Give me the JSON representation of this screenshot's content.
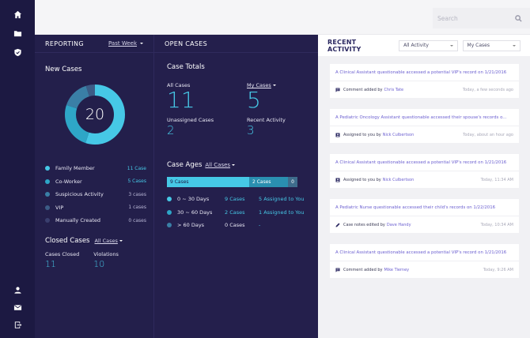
{
  "nav": {
    "top": [
      "home-icon",
      "folder-icon",
      "shield-icon"
    ],
    "bottom": [
      "user-icon",
      "mail-icon",
      "logout-icon"
    ]
  },
  "search": {
    "placeholder": "Search"
  },
  "reporting": {
    "title": "REPORTING",
    "period": "Past Week",
    "new_cases_title": "New Cases",
    "total": "20",
    "legend": [
      {
        "label": "Family Member",
        "count": "11 Case",
        "color": "#46c8e6",
        "value": 11
      },
      {
        "label": "Co-Worker",
        "count": "5 Cases",
        "color": "#2ea6c7",
        "value": 5
      },
      {
        "label": "Suspicious Activity",
        "count": "3 cases",
        "color": "#3a7fa6",
        "value": 3
      },
      {
        "label": "VIP",
        "count": "1 cases",
        "color": "#3c5c86",
        "value": 1
      },
      {
        "label": "Manually Created",
        "count": "0 cases",
        "color": "#3a3f6e",
        "value": 0
      }
    ],
    "closed": {
      "title": "Closed Cases",
      "filter": "All Cases",
      "cases_closed_label": "Cases Closed",
      "cases_closed_value": "11",
      "violations_label": "Violations",
      "violations_value": "10"
    }
  },
  "open_cases": {
    "title": "OPEN CASES",
    "totals_title": "Case Totals",
    "all_label": "All Cases",
    "all_value": "11",
    "my_label": "My Cases",
    "my_value": "5",
    "unassigned_label": "Unassigned Cases",
    "unassigned_value": "2",
    "recent_label": "Recent Activity",
    "recent_value": "3",
    "ages_title": "Case Ages",
    "ages_filter": "All Cases",
    "bar": [
      {
        "label": "9 Cases",
        "value": 9
      },
      {
        "label": "2 Cases",
        "value": 2
      },
      {
        "label": "0",
        "value": 0
      }
    ],
    "ages": [
      {
        "range": "0 ~ 30 Days",
        "cases": "9 Cases",
        "assigned": "5 Assigned to You",
        "color": "#46c8e6"
      },
      {
        "range": "30 ~ 60 Days",
        "cases": "2 Cases",
        "assigned": "1 Assigned to You",
        "color": "#2ea6c7"
      },
      {
        "range": "> 60 Days",
        "cases": "0 Cases",
        "assigned": "-",
        "color": "#3a7fa6"
      }
    ]
  },
  "activity": {
    "title": "RECENT ACTIVITY",
    "filter1": "All Activity",
    "filter2": "My Cases",
    "cards": [
      {
        "title": "A Clinical Assistant questionable accessed a potential VIP's record on 1/21/2016",
        "icon": "comment-icon",
        "action": "Comment added by",
        "by": "Chris Tate",
        "when": "Today, a few seconds ago"
      },
      {
        "title": "A Pediatric Oncology Assistant questionable accessed their spouse's records o...",
        "icon": "assigned-icon",
        "action": "Assigned to you by",
        "by": "Nick Culbertson",
        "when": "Today, about an hour ago"
      },
      {
        "title": "A Clinical Assistant questionable accessed a potential VIP's record on 1/21/2016",
        "icon": "assigned-icon",
        "action": "Assigned to you by",
        "by": "Nick Culbertson",
        "when": "Today, 11:34 AM"
      },
      {
        "title": "A Pediatric Nurse questionable accessed their child's records on 1/22/2016",
        "icon": "pencil-icon",
        "action": "Case notes edited by",
        "by": "Dave Handy",
        "when": "Today, 10:34 AM"
      },
      {
        "title": "A Clinical Assistant questionable accessed a potential VIP's record on 1/21/2016",
        "icon": "comment-icon",
        "action": "Comment added by",
        "by": "Mike Tierney",
        "when": "Today, 9:26 AM"
      }
    ]
  }
}
